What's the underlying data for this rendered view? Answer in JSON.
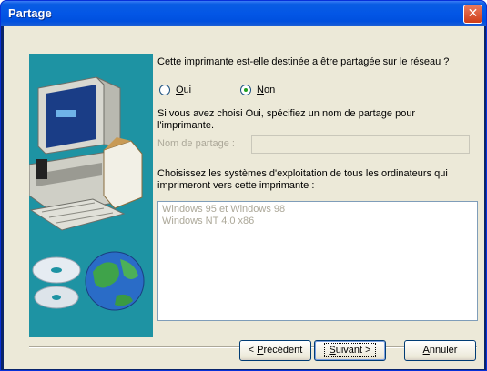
{
  "window": {
    "title": "Partage",
    "close_glyph": "✕"
  },
  "question": "Cette imprimante est-elle destinée a être partagée sur le réseau ?",
  "radios": [
    {
      "label": "Oui",
      "accel": "O",
      "rest": "ui",
      "checked": false
    },
    {
      "label": "Non",
      "accel": "N",
      "rest": "on",
      "checked": true
    }
  ],
  "share_hint": "Si vous avez choisi Oui, spécifiez un nom de partage pour l'imprimante.",
  "share_field": {
    "label": "Nom de partage :",
    "value": ""
  },
  "os_hint": "Choisissez les systèmes d'exploitation de tous les ordinateurs qui imprimeront vers cette imprimante :",
  "os_list": [
    "Windows 95 et Windows 98",
    "Windows NT 4.0 x86"
  ],
  "buttons": {
    "prev": {
      "pre": "< ",
      "accel": "P",
      "rest": "récédent"
    },
    "next": {
      "accel": "S",
      "rest": "uivant >"
    },
    "cancel": {
      "accel": "A",
      "rest": "nnuler"
    }
  },
  "colors": {
    "title_bar": "#0356e6",
    "art_panel": "#1e93a3",
    "dialog_bg": "#ece9d8"
  },
  "icons": [
    "close-icon",
    "computer-illustration",
    "cd-icon",
    "globe-icon"
  ]
}
